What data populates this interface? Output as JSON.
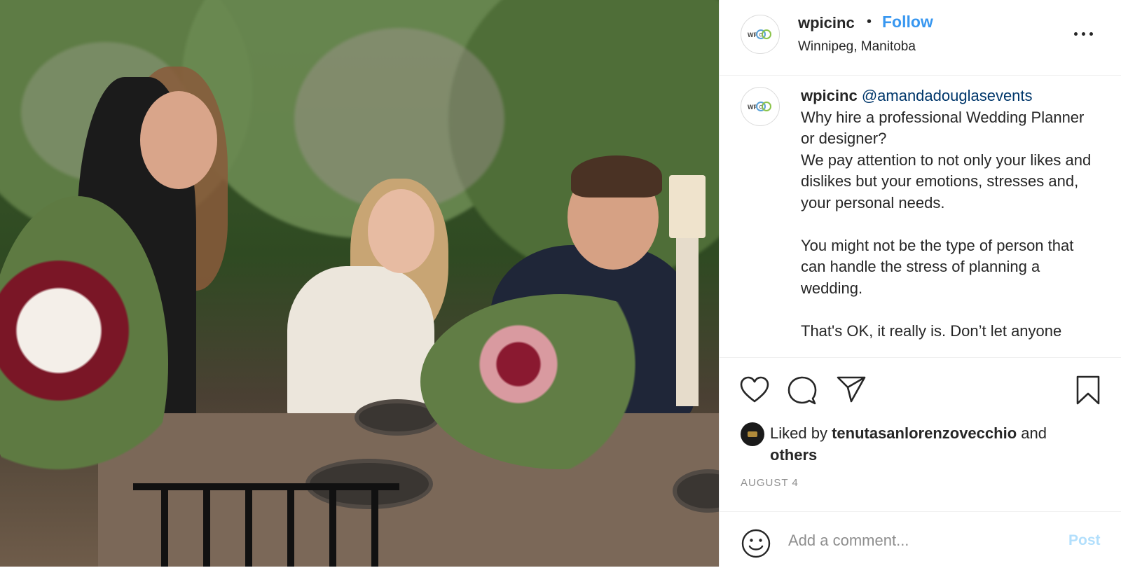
{
  "post": {
    "photo_alt": "Wedding planner toasting with a couple at an outdoor dinner table",
    "header": {
      "username": "wpicinc",
      "separator": "•",
      "follow_label": "Follow",
      "location": "Winnipeg, Manitoba",
      "avatar_icon": "wpic-logo-icon",
      "more_icon": "more-options-icon"
    },
    "caption": {
      "username": "wpicinc",
      "mention": "@amandadouglasevents",
      "text": "Why hire a professional Wedding Planner or designer?\nWe pay attention to not only your likes and dislikes but your emotions, stresses and, your personal needs.\n\nYou might not be the type of person that can handle the stress of planning a wedding.\n\nThat's OK, it really is. Don’t let anyone"
    },
    "actions": {
      "like_icon": "heart-icon",
      "comment_icon": "comment-icon",
      "share_icon": "paper-plane-icon",
      "save_icon": "bookmark-icon"
    },
    "likes": {
      "prefix": "Liked by ",
      "user": "tenutasanlorenzovecchio",
      "connector": " and",
      "others": "others"
    },
    "date": "AUGUST 4",
    "comment": {
      "placeholder": "Add a comment...",
      "post_label": "Post",
      "emoji_icon": "smiley-icon"
    },
    "colors": {
      "follow": "#3897f0",
      "mention": "#00376b",
      "post_disabled": "#b2dffc",
      "muted": "#8e8e8e",
      "text": "#262626"
    }
  }
}
